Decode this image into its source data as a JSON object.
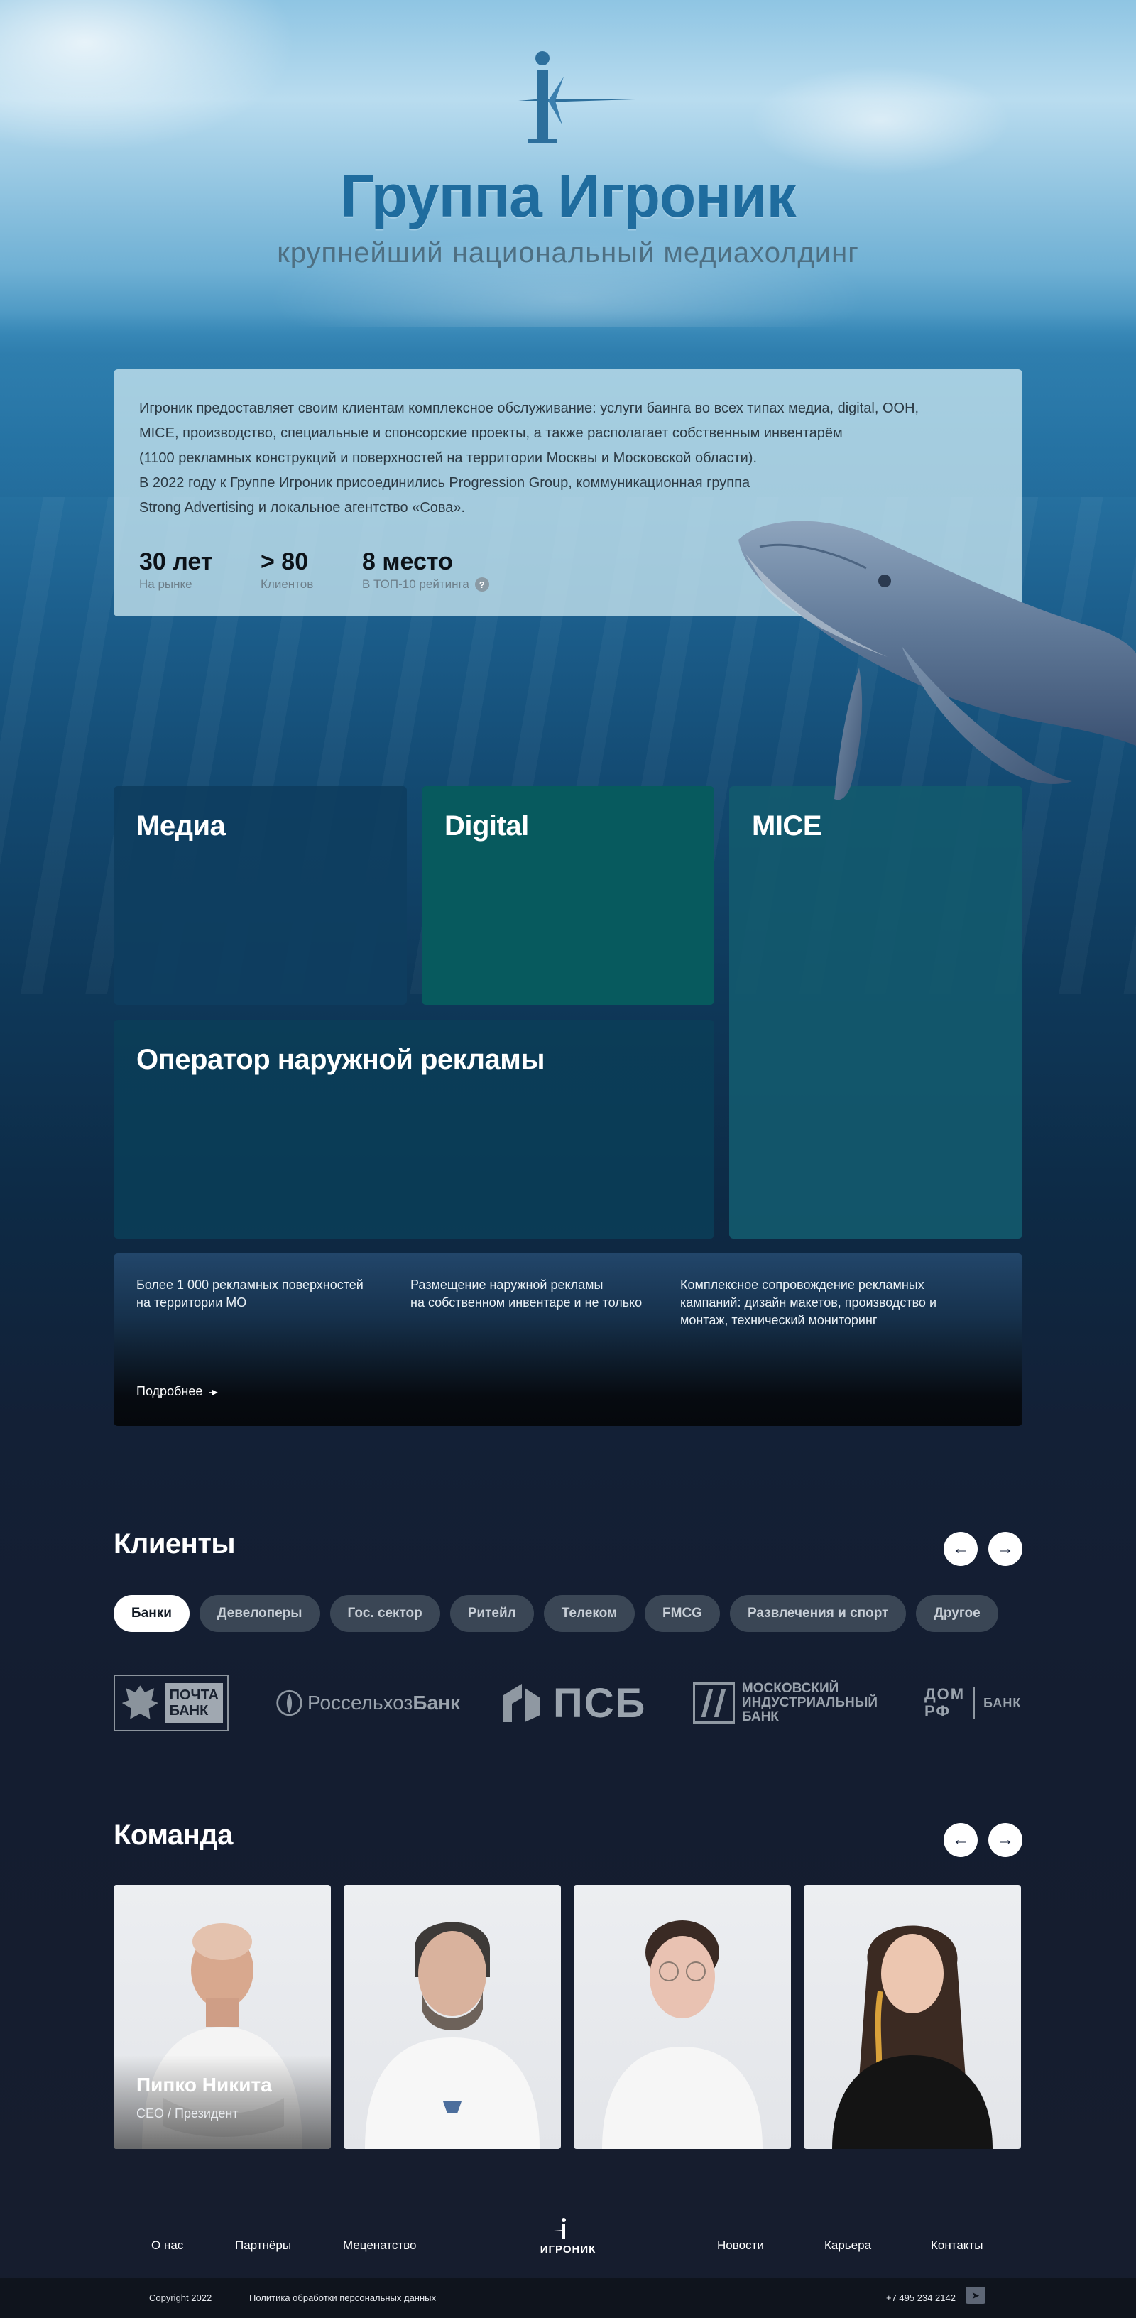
{
  "brand": {
    "title": "Группа Игроник",
    "subtitle": "крупнейший национальный медиахолдинг"
  },
  "about": {
    "lines": [
      "Игроник предоставляет своим клиентам комплексное обслуживание: услуги баинга во всех типах медиа, digital, OOH,",
      "MICE, производство, специальные и спонсорские проекты, а также располагает собственным инвентарём",
      "(1100 рекламных конструкций и поверхностей на территории Москвы и Московской области).",
      "В 2022 году к Группе Игроник присоединились Progression Group, коммуникационная группа",
      "Strong Advertising и локальное агентство «Сова»."
    ],
    "stats": [
      {
        "value": "30 лет",
        "label": "На рынке"
      },
      {
        "value": "> 80",
        "label": "Клиентов"
      },
      {
        "value": "8 место",
        "label": "В ТОП-10 рейтинга"
      }
    ]
  },
  "services": {
    "media": "Медиа",
    "digital": "Digital",
    "mice": "MICE",
    "outdoor": "Оператор наружной рекламы"
  },
  "outdoor_details": {
    "col1": [
      "Более 1 000 рекламных поверхностей",
      "на территории МО"
    ],
    "col2": [
      "Размещение наружной рекламы",
      "на собственном инвентаре и не только"
    ],
    "col3": [
      "Комплексное сопровождение рекламных",
      "кампаний: дизайн макетов, производство и",
      "монтаж, технический мониторинг"
    ],
    "more_label": "Подробнее"
  },
  "clients": {
    "title": "Клиенты",
    "filters": [
      "Банки",
      "Девелоперы",
      "Гос. сектор",
      "Ритейл",
      "Телеком",
      "FMCG",
      "Развлечения и спорт",
      "Другое"
    ],
    "active_filter": "Банки",
    "logos": {
      "pochta": [
        "ПОЧТА",
        "БАНК"
      ],
      "rshb_prefix": "Россельхоз",
      "rshb_suffix": "Банк",
      "psb": "ПСБ",
      "mib": [
        "МОСКОВСКИЙ",
        "ИНДУСТРИАЛЬНЫЙ",
        "БАНК"
      ],
      "domrf_top": "ДОМ",
      "domrf_bottom": "РФ",
      "domrf_bank": "БАНК"
    }
  },
  "team": {
    "title": "Команда",
    "featured": {
      "name": "Пипко Никита",
      "role": "CEO / Президент"
    }
  },
  "footer": {
    "nav_left": [
      "О нас",
      "Партнёры",
      "Меценатство"
    ],
    "nav_right": [
      "Новости",
      "Карьера",
      "Контакты"
    ],
    "logo_text": "ИГРОНИК",
    "copyright": "Copyright 2022",
    "privacy": "Политика обработки персональных данных",
    "phone": "+7 495 234 2142"
  },
  "colors": {
    "brand_blue": "#1f6c9e",
    "digital_tile": "#075a5e",
    "page_dark": "#161d2e"
  }
}
